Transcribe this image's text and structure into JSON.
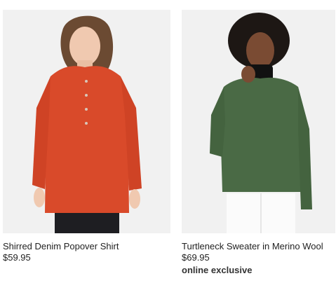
{
  "products": [
    {
      "name": "Shirred Denim Popover Shirt",
      "price": "$59.95",
      "image_icon": "product-photo-icon",
      "color": "#d94a2a"
    },
    {
      "name": "Turtleneck Sweater in Merino Wool",
      "price": "$69.95",
      "badge": "online exclusive",
      "image_icon": "product-photo-icon",
      "color": "#4a6a45"
    }
  ]
}
